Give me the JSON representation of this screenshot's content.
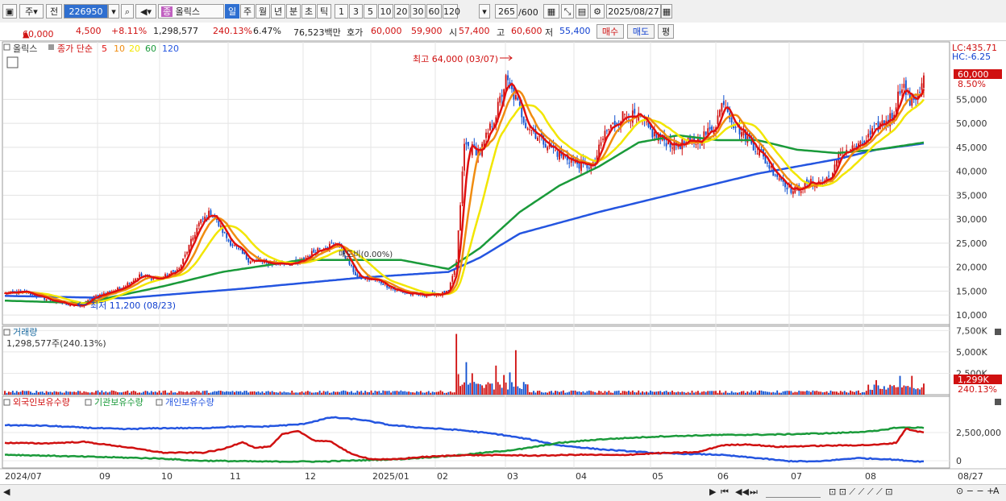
{
  "toolbar": {
    "period_type": "주",
    "prev_label": "전",
    "stock_code": "226950",
    "stock_name": "올릭스",
    "intervals": [
      "일",
      "주",
      "월",
      "년",
      "분",
      "초",
      "틱"
    ],
    "active_interval": "일",
    "multipliers": [
      "1",
      "3",
      "5",
      "10",
      "20",
      "30",
      "60",
      "120"
    ],
    "count": "265",
    "count_total": "/600",
    "date": "2025/08/27"
  },
  "quote": {
    "price": "60,000",
    "change": "4,500",
    "change_pct": "+8.11%",
    "volume": "1,298,577",
    "volume_ratio": "240.13%",
    "turnover": "6.47%",
    "amount": "76,523백만",
    "hoga_label": "호가",
    "ask": "60,000",
    "bid": "59,900",
    "open_label": "시",
    "open": "57,400",
    "high_label": "고",
    "high": "60,600",
    "low_label": "저",
    "low": "55,400",
    "buy_label": "매수",
    "sell_label": "매도",
    "eval_label": "평"
  },
  "chart_data": [
    {
      "type": "candlestick",
      "legend_stock": "올릭스",
      "legend_ma_label": "종가 단순",
      "ma_periods": [
        "5",
        "10",
        "20",
        "60",
        "120"
      ],
      "colors": {
        "up": "#d01010",
        "down": "#1050d0",
        "ma5": "#e01010",
        "ma10": "#f08c10",
        "ma20": "#f2e600",
        "ma60": "#1a9a3a",
        "ma120": "#2455e0"
      },
      "y_ticks": [
        "10,000",
        "15,000",
        "20,000",
        "25,000",
        "30,000",
        "35,000",
        "40,000",
        "45,000",
        "50,000",
        "55,000"
      ],
      "ylim": [
        8000,
        67000
      ],
      "x_ticks": [
        "2024/07",
        "09",
        "10",
        "11",
        "12",
        "2025/01",
        "02",
        "03",
        "04",
        "05",
        "06",
        "07",
        "08",
        "08/27"
      ],
      "lc_label": "LC:435.71",
      "hc_label": "HC:-6.25",
      "last_price_label": "60,000",
      "last_pct_label": "8.50%",
      "max_annotation": "최고 64,000 (03/07)",
      "min_annotation": "최저 11,200 (08/23)",
      "mid_annotation": "매도비(0.00%)",
      "close_anchors": [
        [
          0,
          14500
        ],
        [
          10,
          14800
        ],
        [
          25,
          12800
        ],
        [
          38,
          11800
        ],
        [
          45,
          13800
        ],
        [
          58,
          15500
        ],
        [
          68,
          18200
        ],
        [
          78,
          17500
        ],
        [
          88,
          19600
        ],
        [
          98,
          29000
        ],
        [
          104,
          31500
        ],
        [
          113,
          25500
        ],
        [
          123,
          21500
        ],
        [
          133,
          20800
        ],
        [
          148,
          20800
        ],
        [
          158,
          23800
        ],
        [
          168,
          25000
        ],
        [
          178,
          17800
        ],
        [
          188,
          17200
        ],
        [
          198,
          15000
        ],
        [
          208,
          14200
        ],
        [
          218,
          14300
        ],
        [
          224,
          14800
        ],
        [
          228,
          21000
        ],
        [
          232,
          45500
        ],
        [
          240,
          44000
        ],
        [
          248,
          52000
        ],
        [
          253,
          59000
        ],
        [
          258,
          55000
        ],
        [
          263,
          50000
        ],
        [
          270,
          47000
        ],
        [
          280,
          43500
        ],
        [
          290,
          41500
        ],
        [
          297,
          41000
        ],
        [
          303,
          48000
        ],
        [
          313,
          52000
        ],
        [
          320,
          51000
        ],
        [
          328,
          47500
        ],
        [
          338,
          45500
        ],
        [
          348,
          46000
        ],
        [
          358,
          49000
        ],
        [
          363,
          55000
        ],
        [
          368,
          50000
        ],
        [
          378,
          45500
        ],
        [
          388,
          40000
        ],
        [
          398,
          35800
        ],
        [
          406,
          37500
        ],
        [
          413,
          37800
        ],
        [
          418,
          39500
        ],
        [
          422,
          44000
        ],
        [
          432,
          45200
        ],
        [
          442,
          49800
        ],
        [
          448,
          51500
        ],
        [
          453,
          58500
        ],
        [
          457,
          54500
        ],
        [
          461,
          56000
        ],
        [
          464,
          60000
        ]
      ],
      "ma60_anchors": [
        [
          0,
          13000
        ],
        [
          40,
          12500
        ],
        [
          80,
          16000
        ],
        [
          110,
          19000
        ],
        [
          150,
          21500
        ],
        [
          200,
          21500
        ],
        [
          224,
          19600
        ],
        [
          240,
          24000
        ],
        [
          260,
          31500
        ],
        [
          280,
          37000
        ],
        [
          300,
          41000
        ],
        [
          320,
          46000
        ],
        [
          340,
          47500
        ],
        [
          360,
          46500
        ],
        [
          380,
          46500
        ],
        [
          400,
          44500
        ],
        [
          420,
          43800
        ],
        [
          440,
          44500
        ],
        [
          464,
          46000
        ]
      ],
      "ma120_anchors": [
        [
          0,
          14000
        ],
        [
          60,
          13500
        ],
        [
          120,
          15500
        ],
        [
          180,
          17800
        ],
        [
          224,
          19000
        ],
        [
          240,
          22000
        ],
        [
          260,
          27000
        ],
        [
          300,
          31500
        ],
        [
          340,
          35500
        ],
        [
          380,
          39500
        ],
        [
          420,
          42500
        ],
        [
          440,
          44500
        ],
        [
          464,
          45800
        ]
      ]
    },
    {
      "type": "bar",
      "legend": "거래량",
      "summary": "1,298,577주(240.13%)",
      "y_ticks": [
        "7,500K",
        "5,000K",
        "2,500K"
      ],
      "ylim": [
        0,
        8000000
      ],
      "last_label": "1,299K",
      "last_pct_label": "240.13%",
      "spikes": [
        [
          228,
          7100000
        ],
        [
          229,
          2400000
        ],
        [
          233,
          3800000
        ],
        [
          236,
          2500000
        ],
        [
          248,
          3400000
        ],
        [
          252,
          2300000
        ],
        [
          255,
          2600000
        ],
        [
          258,
          5200000
        ],
        [
          264,
          1200000
        ],
        [
          440,
          1700000
        ],
        [
          452,
          2200000
        ],
        [
          458,
          2200000
        ],
        [
          464,
          1300000
        ]
      ]
    },
    {
      "type": "line",
      "series_names": [
        "외국인보유수량",
        "기관보유수량",
        "개인보유수량"
      ],
      "y_ticks": [
        "2,500,000",
        "0"
      ],
      "foreign_anchors": [
        [
          0,
          0.74
        ],
        [
          20,
          0.73
        ],
        [
          40,
          0.69
        ],
        [
          60,
          0.66
        ],
        [
          80,
          0.68
        ],
        [
          100,
          0.68
        ],
        [
          115,
          0.71
        ],
        [
          130,
          0.71
        ],
        [
          150,
          0.76
        ],
        [
          165,
          0.9
        ],
        [
          180,
          0.85
        ],
        [
          195,
          0.74
        ],
        [
          210,
          0.69
        ],
        [
          230,
          0.64
        ],
        [
          250,
          0.55
        ],
        [
          265,
          0.45
        ],
        [
          280,
          0.33
        ],
        [
          300,
          0.25
        ],
        [
          330,
          0.17
        ],
        [
          360,
          0.14
        ],
        [
          380,
          0.07
        ],
        [
          395,
          0.01
        ],
        [
          410,
          0.0
        ],
        [
          430,
          0.07
        ],
        [
          445,
          0.05
        ],
        [
          458,
          0.01
        ],
        [
          464,
          0.0
        ]
      ],
      "inst_anchors": [
        [
          0,
          0.14
        ],
        [
          40,
          0.1
        ],
        [
          80,
          0.06
        ],
        [
          95,
          0.02
        ],
        [
          130,
          0.0
        ],
        [
          160,
          0.0
        ],
        [
          200,
          0.05
        ],
        [
          230,
          0.13
        ],
        [
          260,
          0.25
        ],
        [
          280,
          0.38
        ],
        [
          300,
          0.45
        ],
        [
          330,
          0.51
        ],
        [
          360,
          0.54
        ],
        [
          390,
          0.55
        ],
        [
          420,
          0.58
        ],
        [
          440,
          0.62
        ],
        [
          450,
          0.69
        ],
        [
          458,
          0.69
        ],
        [
          464,
          0.69
        ]
      ],
      "retail_anchors": [
        [
          0,
          0.38
        ],
        [
          20,
          0.37
        ],
        [
          40,
          0.4
        ],
        [
          60,
          0.3
        ],
        [
          80,
          0.18
        ],
        [
          100,
          0.18
        ],
        [
          110,
          0.25
        ],
        [
          120,
          0.4
        ],
        [
          126,
          0.28
        ],
        [
          134,
          0.3
        ],
        [
          140,
          0.55
        ],
        [
          148,
          0.63
        ],
        [
          156,
          0.43
        ],
        [
          165,
          0.4
        ],
        [
          175,
          0.15
        ],
        [
          185,
          0.05
        ],
        [
          195,
          0.04
        ],
        [
          210,
          0.09
        ],
        [
          230,
          0.13
        ],
        [
          250,
          0.13
        ],
        [
          270,
          0.12
        ],
        [
          290,
          0.14
        ],
        [
          310,
          0.13
        ],
        [
          330,
          0.17
        ],
        [
          350,
          0.19
        ],
        [
          362,
          0.33
        ],
        [
          375,
          0.35
        ],
        [
          390,
          0.3
        ],
        [
          410,
          0.32
        ],
        [
          425,
          0.33
        ],
        [
          440,
          0.34
        ],
        [
          450,
          0.38
        ],
        [
          455,
          0.67
        ],
        [
          460,
          0.62
        ],
        [
          464,
          0.59
        ]
      ]
    }
  ]
}
